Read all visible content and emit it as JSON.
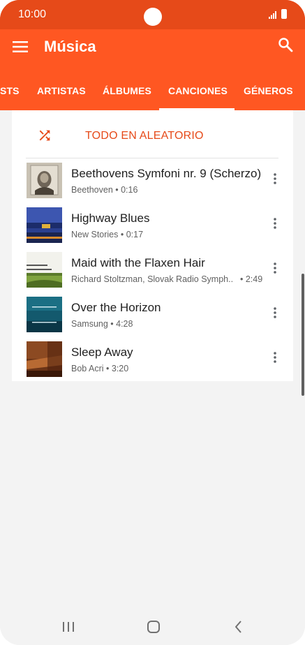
{
  "status_bar": {
    "time": "10:00"
  },
  "app_bar": {
    "title": "Música"
  },
  "tabs": [
    {
      "label": "STS"
    },
    {
      "label": "ARTISTAS"
    },
    {
      "label": "ÁLBUMES"
    },
    {
      "label": "CANCIONES"
    },
    {
      "label": "GÉNEROS"
    }
  ],
  "selected_tab": "CANCIONES",
  "shuffle": {
    "label": "TODO EN ALEATORIO"
  },
  "songs": [
    {
      "title": "Beethovens Symfoni nr. 9 (Scherzo)",
      "meta": "Beethoven • 0:16",
      "art": "beethoven-art"
    },
    {
      "title": "Highway Blues",
      "meta": "New Stories • 0:17",
      "art": "highway-art"
    },
    {
      "title": "Maid with the Flaxen Hair",
      "artist": "Richard Stoltzman, Slovak Radio Symph..",
      "duration": "• 2:49",
      "art": "stoltzman-art"
    },
    {
      "title": "Over the Horizon",
      "meta": "Samsung • 4:28",
      "art": "horizon-art"
    },
    {
      "title": "Sleep Away",
      "meta": "Bob Acri • 3:20",
      "art": "sleepaway-art"
    }
  ],
  "colors": {
    "accent": "#ff5722",
    "status_bar": "#e64a19",
    "shuffle_text": "#e64a19"
  },
  "icons": [
    "menu-icon",
    "search-icon",
    "shuffle-icon",
    "more-vert-icon",
    "recent-apps-icon",
    "home-icon",
    "back-icon"
  ]
}
